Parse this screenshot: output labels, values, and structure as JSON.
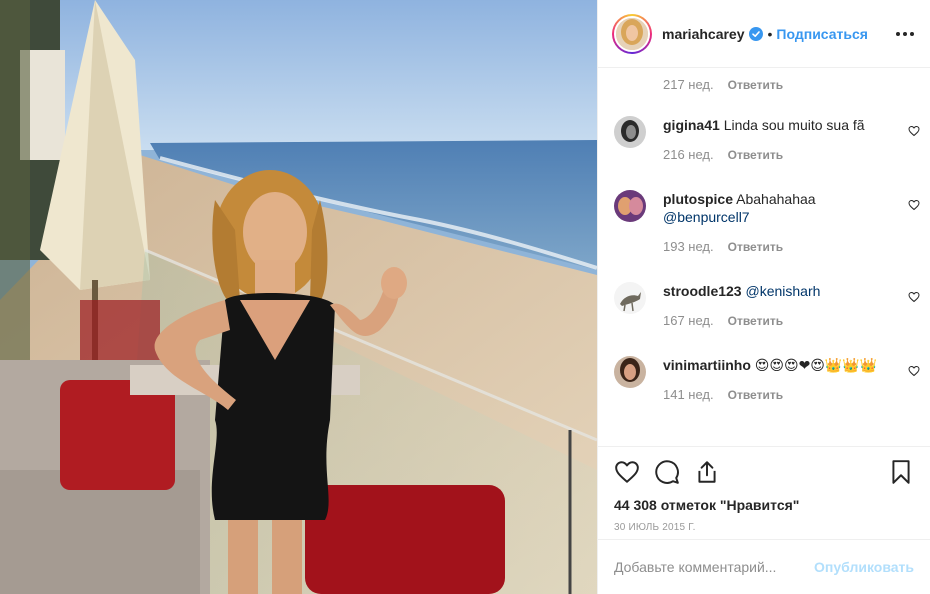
{
  "post": {
    "photo_icon": "beach-photo"
  },
  "header": {
    "username": "mariahcarey",
    "separator": "•",
    "follow_label": "Подписаться",
    "verified_icon": "verified-badge-icon",
    "more_icon": "more-options-icon"
  },
  "comments": {
    "first_meta": {
      "weeks": "217 нед.",
      "reply": "Ответить"
    },
    "items": [
      {
        "user": "gigina41",
        "text": "Linda sou muito sua fã",
        "mention": "",
        "weeks": "216 нед.",
        "reply": "Ответить"
      },
      {
        "user": "plutospice",
        "text": "Abahahahaa",
        "mention": "@benpurcell7",
        "weeks": "193 нед.",
        "reply": "Ответить"
      },
      {
        "user": "stroodle123",
        "text": "",
        "mention": "@kenisharh",
        "weeks": "167 нед.",
        "reply": "Ответить"
      },
      {
        "user": "vinimartiinho",
        "text": "😍😍😍❤😍👑👑👑",
        "mention": "",
        "weeks": "141 нед.",
        "reply": "Ответить"
      }
    ]
  },
  "actions": {
    "likes": "44 308 отметок \"Нравится\"",
    "date": "30 июль 2015 г."
  },
  "add_comment": {
    "placeholder": "Добавьте комментарий...",
    "publish_label": "Опубликовать"
  },
  "colors": {
    "accent": "#3897f0",
    "publish_disabled": "#b2dffc",
    "muted": "#8e8e8e"
  }
}
